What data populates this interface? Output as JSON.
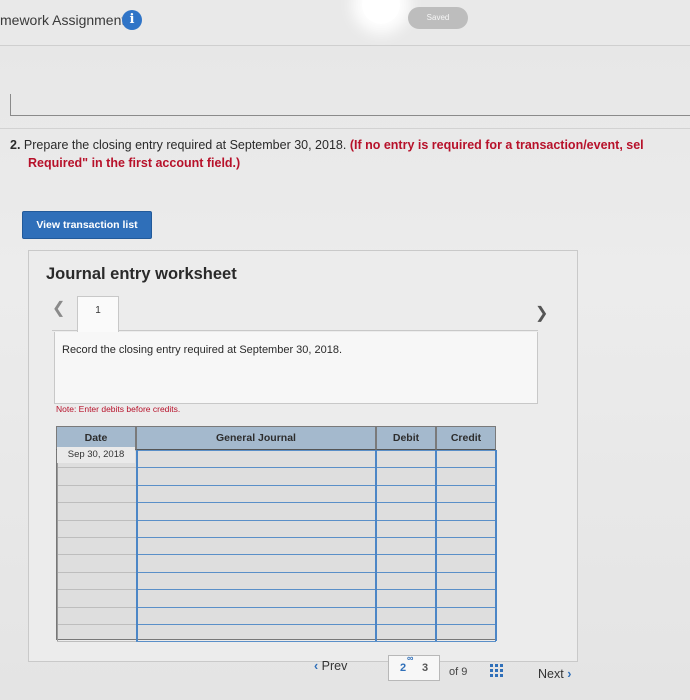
{
  "header": {
    "title": "mework Assignment",
    "info_icon": "info-icon",
    "saved_label": "Saved"
  },
  "question": {
    "number": "2.",
    "text": "Prepare the closing entry required at September 30, 2018.",
    "instruction_line1": "(If no entry is required for a transaction/event, sel",
    "instruction_line2": "Required\" in the first account field.)"
  },
  "buttons": {
    "view_transaction_list": "View transaction list"
  },
  "worksheet": {
    "title": "Journal entry worksheet",
    "tab_label": "1",
    "nav_prev_icon": "chevron-left-icon",
    "nav_next_icon": "chevron-right-icon",
    "record_text": "Record the closing entry required at September 30, 2018.",
    "note": "Note: Enter debits before credits."
  },
  "table": {
    "columns": [
      "Date",
      "General Journal",
      "Debit",
      "Credit"
    ],
    "rows": [
      {
        "date": "Sep 30, 2018",
        "account": "",
        "debit": "",
        "credit": ""
      },
      {
        "date": "",
        "account": "",
        "debit": "",
        "credit": ""
      },
      {
        "date": "",
        "account": "",
        "debit": "",
        "credit": ""
      },
      {
        "date": "",
        "account": "",
        "debit": "",
        "credit": ""
      },
      {
        "date": "",
        "account": "",
        "debit": "",
        "credit": ""
      },
      {
        "date": "",
        "account": "",
        "debit": "",
        "credit": ""
      },
      {
        "date": "",
        "account": "",
        "debit": "",
        "credit": ""
      },
      {
        "date": "",
        "account": "",
        "debit": "",
        "credit": ""
      },
      {
        "date": "",
        "account": "",
        "debit": "",
        "credit": ""
      },
      {
        "date": "",
        "account": "",
        "debit": "",
        "credit": ""
      },
      {
        "date": "",
        "account": "",
        "debit": "",
        "credit": ""
      }
    ]
  },
  "pager": {
    "prev_label": "Prev",
    "current_page": "2",
    "next_page": "3",
    "of_label": "of 9",
    "grid_icon": "grid-icon",
    "next_label": "Next"
  },
  "colors": {
    "accent": "#2f6fb9",
    "instruction_red": "#b7112a",
    "table_header": "#a4b9cd"
  }
}
